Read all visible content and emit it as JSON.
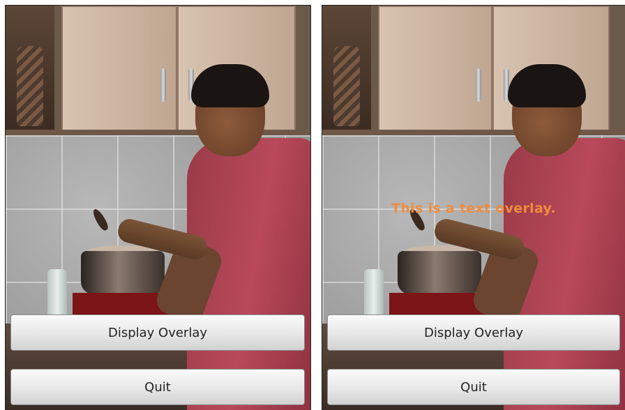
{
  "screens": [
    {
      "id": "before",
      "overlay_text": "",
      "buttons": {
        "display_overlay": "Display Overlay",
        "quit": "Quit"
      }
    },
    {
      "id": "after",
      "overlay_text": "This is a text overlay.",
      "buttons": {
        "display_overlay": "Display Overlay",
        "quit": "Quit"
      }
    }
  ],
  "colors": {
    "overlay_text": "#f08d3e",
    "button_text": "#222222"
  }
}
